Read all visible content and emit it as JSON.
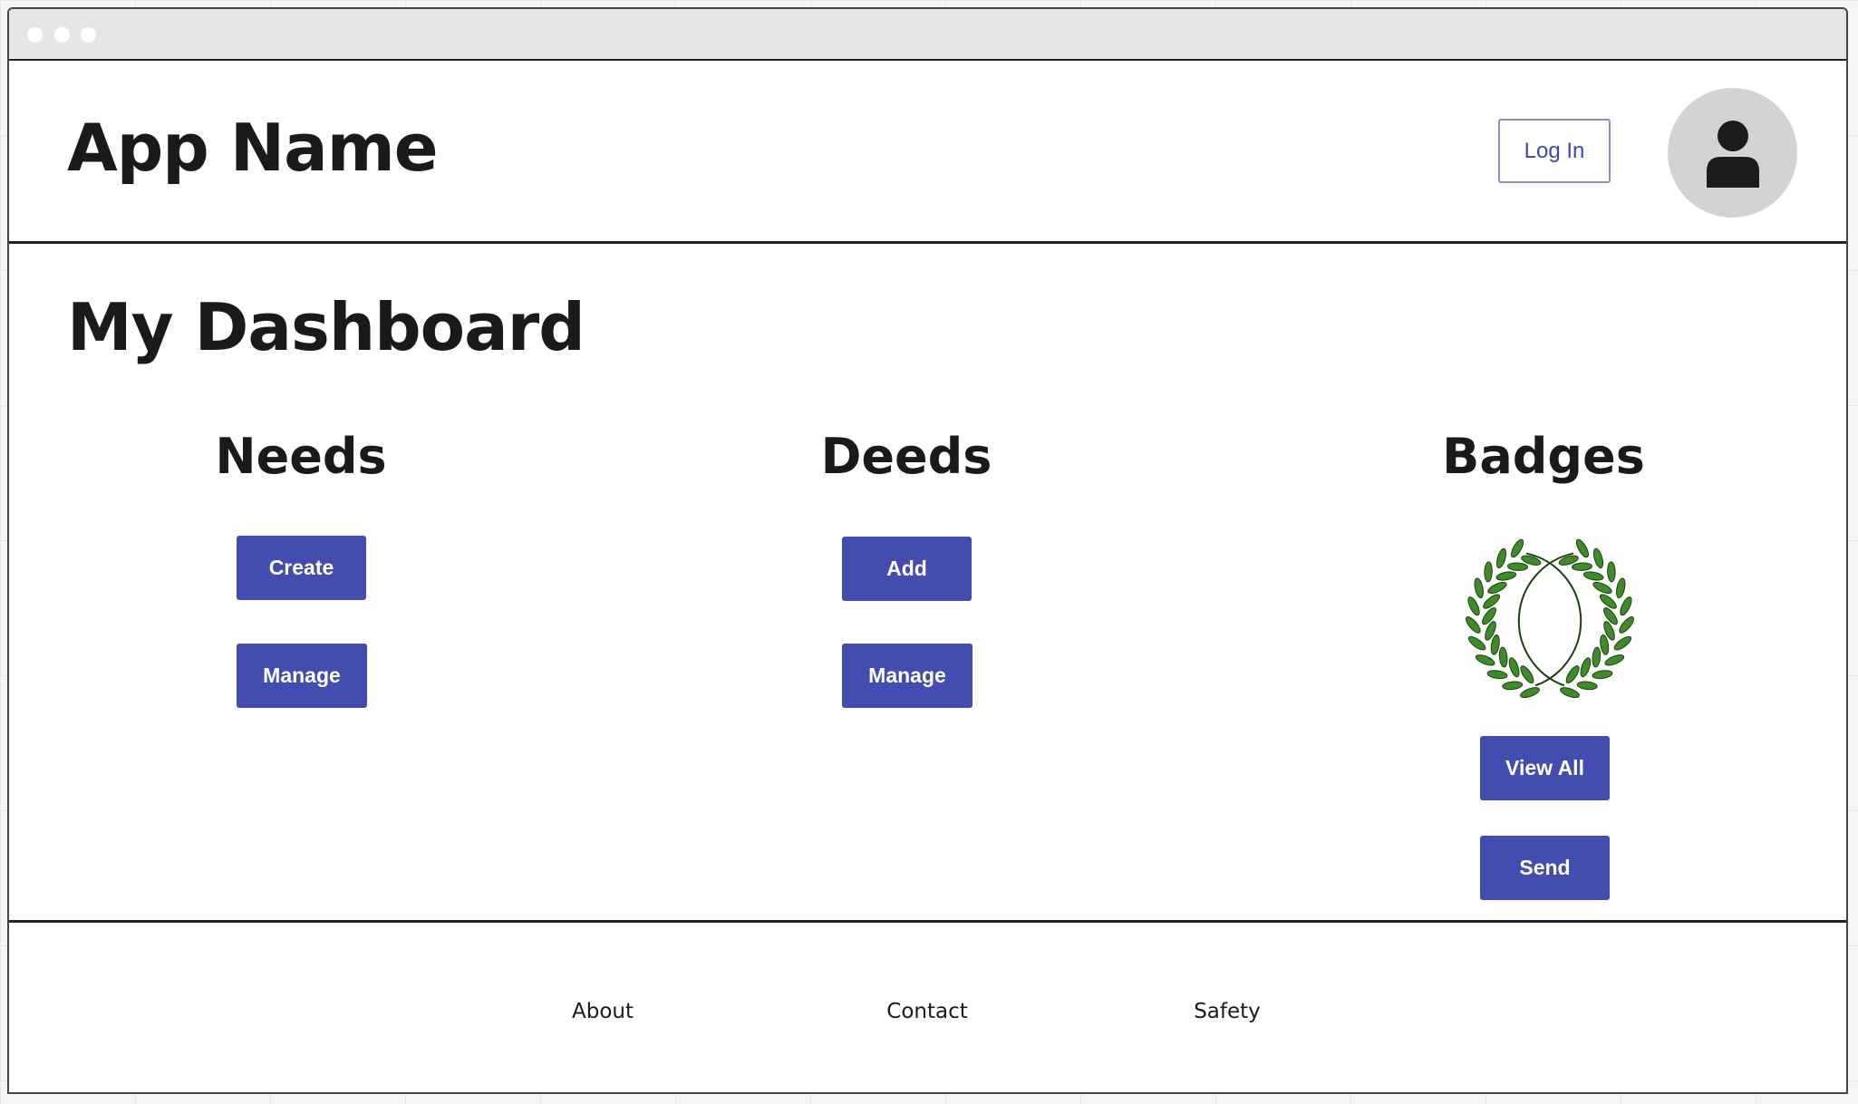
{
  "header": {
    "app_name": "App Name",
    "login_label": "Log In",
    "avatar_icon": "user-icon"
  },
  "main": {
    "title": "My Dashboard",
    "sections": [
      {
        "title": "Needs",
        "buttons": [
          "Create",
          "Manage"
        ]
      },
      {
        "title": "Deeds",
        "buttons": [
          "Add",
          "Manage"
        ]
      },
      {
        "title": "Badges",
        "icon": "laurel-wreath-icon",
        "buttons": [
          "View All",
          "Send"
        ]
      }
    ]
  },
  "footer": {
    "links": [
      "About",
      "Contact",
      "Safety"
    ]
  },
  "colors": {
    "primary": "#434caf",
    "login_text": "#3d47b0",
    "login_border": "#8a8fc9",
    "avatar_bg": "#d3d3d3",
    "wreath_leaf": "#3f8a2a"
  }
}
